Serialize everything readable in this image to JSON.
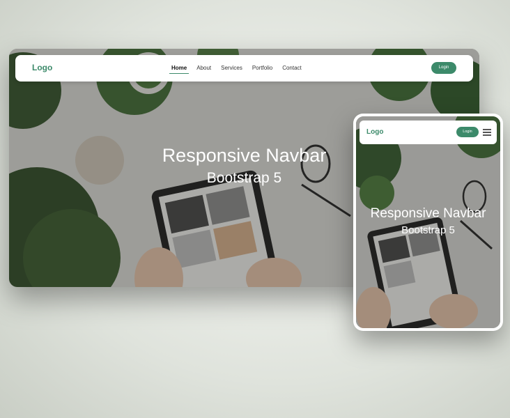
{
  "desktop": {
    "logo": "Logo",
    "nav": [
      {
        "label": "Home",
        "active": true
      },
      {
        "label": "About",
        "active": false
      },
      {
        "label": "Services",
        "active": false
      },
      {
        "label": "Portfolio",
        "active": false
      },
      {
        "label": "Contact",
        "active": false
      }
    ],
    "login": "Login",
    "hero_title": "Responsive Navbar",
    "hero_subtitle": "Bootstrap 5"
  },
  "mobile": {
    "logo": "Logo",
    "login": "Login",
    "menu_icon": "hamburger-icon",
    "hero_title": "Responsive Navbar",
    "hero_subtitle": "Bootstrap 5"
  },
  "colors": {
    "accent": "#3c8a6a"
  }
}
